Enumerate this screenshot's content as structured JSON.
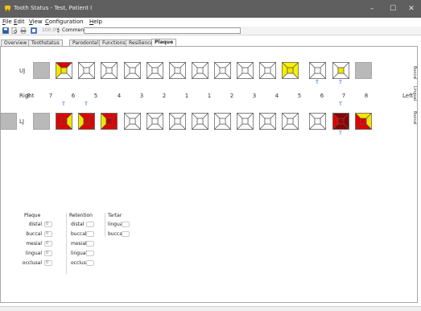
{
  "window": {
    "title": "Tooth Status - Test, Patient I",
    "minimize": "–",
    "maximize": "☐",
    "close": "✕"
  },
  "menu": [
    {
      "mn": "F",
      "rest": "ile"
    },
    {
      "mn": "E",
      "rest": "dit"
    },
    {
      "mn": "V",
      "rest": "iew"
    },
    {
      "mn": "C",
      "rest": "onfiguration"
    },
    {
      "mn": "H",
      "rest": "elp"
    }
  ],
  "toolbar": {
    "zoom": "100.0%",
    "comment_label": "Comment:",
    "comment_value": ""
  },
  "tabs": [
    "Overview",
    "Toothstatus",
    "Parodontal",
    "Functions",
    "Resilience",
    "Plaque"
  ],
  "active_tab": "Plaque",
  "chart": {
    "upper_label": "UJ",
    "lower_label": "LJ",
    "right_label": "Right",
    "left_label": "Left",
    "numbers": [
      "8",
      "7",
      "6",
      "5",
      "4",
      "3",
      "2",
      "1",
      "1",
      "2",
      "3",
      "4",
      "5",
      "6",
      "7",
      "8"
    ],
    "side_labels": {
      "buccal_top": "Buccal",
      "lingual": "Lingual",
      "buccal_bottom": "Buccal"
    },
    "upper_teeth": [
      {
        "state": "missing"
      },
      {
        "state": "colored",
        "top": "#e00000",
        "left": "#f2e600",
        "right": "#ffffff",
        "bottom": "#ffffff",
        "center": "#f2e600"
      },
      {
        "state": "empty"
      },
      {
        "state": "empty"
      },
      {
        "state": "empty"
      },
      {
        "state": "empty"
      },
      {
        "state": "empty"
      },
      {
        "state": "empty"
      },
      {
        "state": "empty"
      },
      {
        "state": "empty"
      },
      {
        "state": "empty"
      },
      {
        "state": "colored",
        "top": "#f7f000",
        "left": "#f7f000",
        "right": "#f7f000",
        "bottom": "#ffffff",
        "center": "#f2e600"
      },
      {
        "state": "empty"
      },
      {
        "state": "colored",
        "top": "#ffffff",
        "left": "#ffffff",
        "right": "#ffffff",
        "bottom": "#ffffff",
        "center": "#f2e600"
      },
      {
        "state": "missing"
      }
    ],
    "upper_marks": [
      {
        "slot": 12,
        "text": "T"
      },
      {
        "slot": 13,
        "text": "T"
      }
    ],
    "lower_marks_top": [
      {
        "slot": 1,
        "text": "T"
      },
      {
        "slot": 2,
        "text": "T"
      },
      {
        "slot": 13,
        "text": "T"
      }
    ],
    "lower_marks_bottom": [
      {
        "slot": 13,
        "text": "T"
      }
    ],
    "lower_teeth": [
      {
        "state": "missing"
      },
      {
        "state": "colored",
        "top": "#e00000",
        "left": "#e00000",
        "right": "#f2e600",
        "bottom": "#e00000",
        "center": "#e00000"
      },
      {
        "state": "colored",
        "top": "#e00000",
        "left": "#f2e600",
        "right": "#e00000",
        "bottom": "#e00000",
        "center": "#e00000"
      },
      {
        "state": "colored",
        "top": "#e00000",
        "left": "#f2e600",
        "right": "#e00000",
        "bottom": "#e00000",
        "center": "#c00000"
      },
      {
        "state": "empty"
      },
      {
        "state": "empty"
      },
      {
        "state": "empty"
      },
      {
        "state": "empty"
      },
      {
        "state": "empty"
      },
      {
        "state": "empty"
      },
      {
        "state": "empty"
      },
      {
        "state": "empty"
      },
      {
        "state": "empty"
      },
      {
        "state": "colored",
        "top": "#8b0000",
        "left": "#e00000",
        "right": "#8b0000",
        "bottom": "#8b0000",
        "center": "#a00000"
      },
      {
        "state": "colored",
        "top": "#f2e600",
        "left": "#e00000",
        "right": "#f2e600",
        "bottom": "#e00000",
        "center": "#e00000"
      },
      {
        "state": "missing"
      }
    ]
  },
  "legend": {
    "plaque": {
      "title": "Plaque",
      "fields": [
        {
          "label": "distal",
          "value": "0"
        },
        {
          "label": "buccal",
          "value": "0"
        },
        {
          "label": "mesial",
          "value": "0"
        },
        {
          "label": "lingual",
          "value": "0"
        },
        {
          "label": "occlusal",
          "value": "0"
        }
      ]
    },
    "retention": {
      "title": "Retention",
      "fields": [
        "distal",
        "buccal",
        "mesial",
        "lingual",
        "occlusal"
      ]
    },
    "tartar": {
      "title": "Tartar",
      "fields": [
        "lingual",
        "buccal"
      ]
    }
  },
  "colors": {
    "titlebar": "#5f5f5f",
    "missing_tooth": "#b9b9b9",
    "plaque_red": "#e00000",
    "plaque_yellow": "#f2e600",
    "plaque_dark": "#8b0000",
    "mark_blue": "#2a4fd6"
  }
}
